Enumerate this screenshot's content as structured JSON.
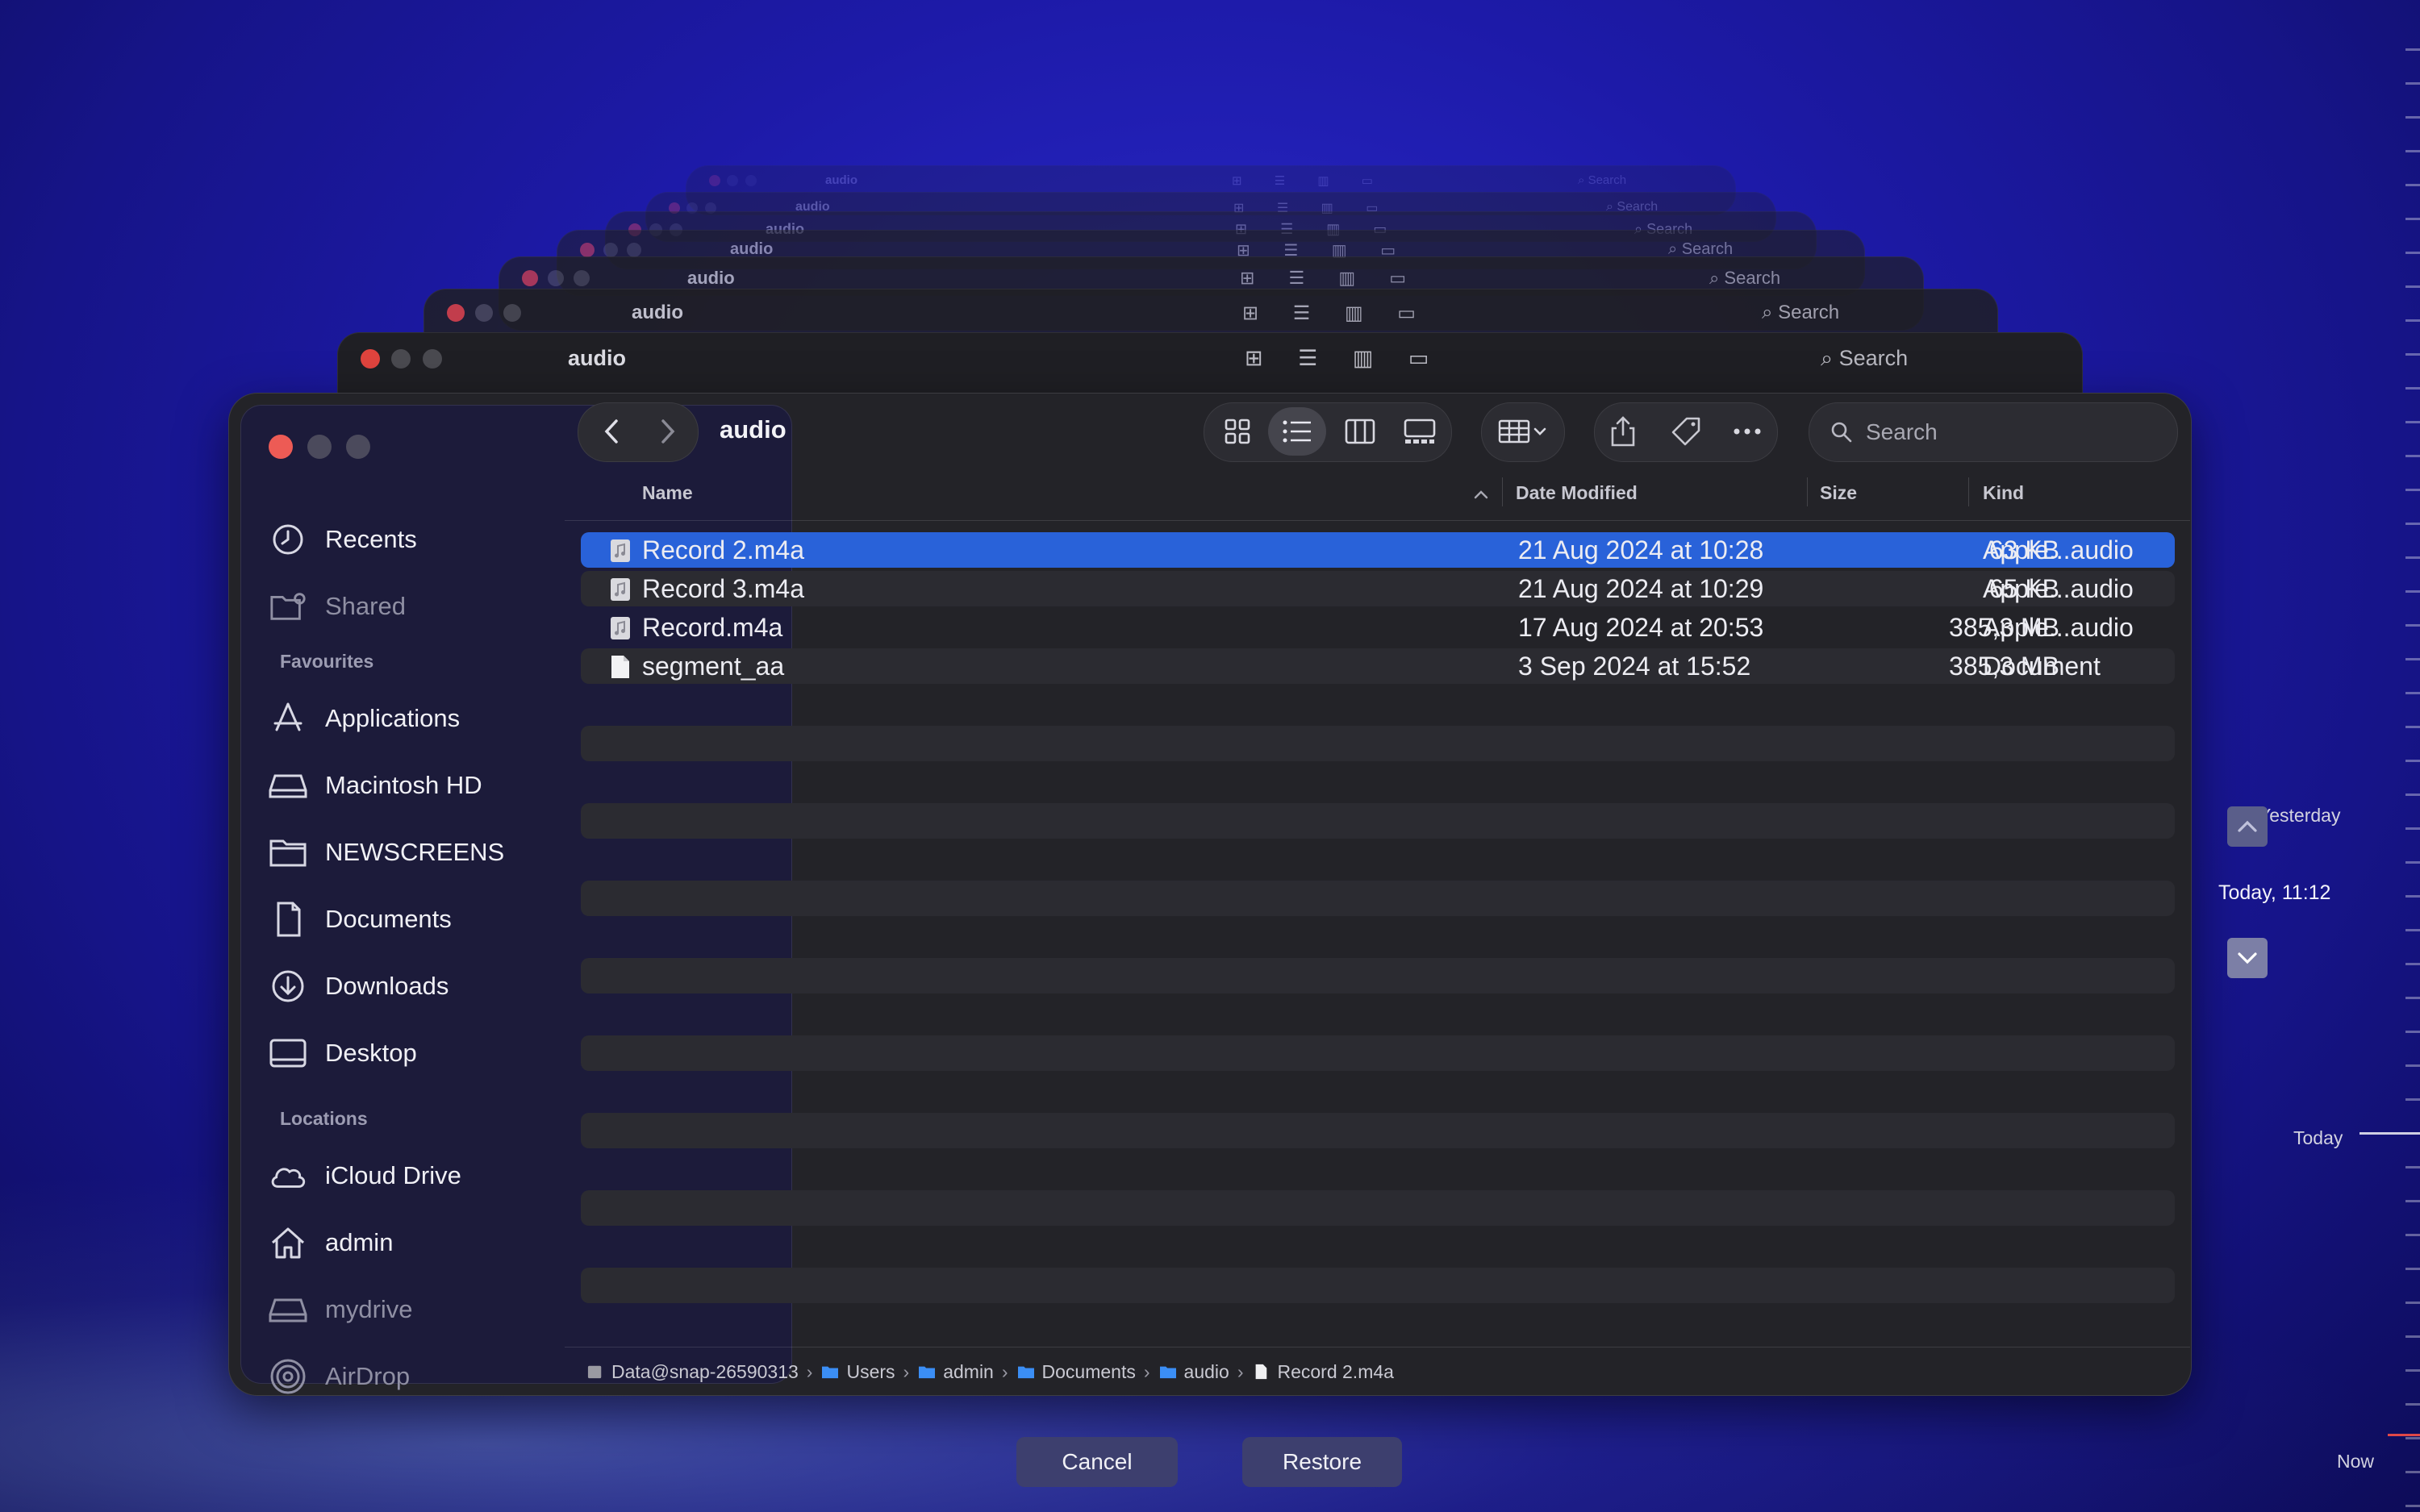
{
  "background_accent": "#1d1aa8",
  "ghost_windows": [
    {
      "title": "audio",
      "search": "Search"
    },
    {
      "title": "audio",
      "search": "Search"
    },
    {
      "title": "audio",
      "search": "Search"
    },
    {
      "title": "audio",
      "search": "Search"
    },
    {
      "title": "audio",
      "search": "Search"
    },
    {
      "title": "audio",
      "search": "Search"
    },
    {
      "title": "audio",
      "search": "Search"
    }
  ],
  "window": {
    "title": "audio",
    "search_placeholder": "Search"
  },
  "sidebar": {
    "top_items": [
      {
        "label": "Recents",
        "icon": "clock-icon"
      },
      {
        "label": "Shared",
        "icon": "shared-folder-icon"
      }
    ],
    "favourites_heading": "Favourites",
    "favourites": [
      {
        "label": "Applications",
        "icon": "applications-icon"
      },
      {
        "label": "Macintosh HD",
        "icon": "drive-icon"
      },
      {
        "label": "NEWSCREENS",
        "icon": "folder-icon"
      },
      {
        "label": "Documents",
        "icon": "document-icon"
      },
      {
        "label": "Downloads",
        "icon": "download-icon"
      },
      {
        "label": "Desktop",
        "icon": "desktop-icon"
      }
    ],
    "locations_heading": "Locations",
    "locations": [
      {
        "label": "iCloud Drive",
        "icon": "cloud-icon"
      },
      {
        "label": "admin",
        "icon": "home-icon"
      },
      {
        "label": "mydrive",
        "icon": "drive-icon"
      },
      {
        "label": "AirDrop",
        "icon": "airdrop-icon"
      }
    ]
  },
  "columns": {
    "name": "Name",
    "date": "Date Modified",
    "size": "Size",
    "kind": "Kind"
  },
  "files": [
    {
      "name": "Record 2.m4a",
      "date": "21 Aug 2024 at 10:28",
      "size": "63 KB",
      "kind": "Apple...audio",
      "selected": true
    },
    {
      "name": "Record 3.m4a",
      "date": "21 Aug 2024 at 10:29",
      "size": "65 KB",
      "kind": "Apple...audio",
      "selected": false
    },
    {
      "name": "Record.m4a",
      "date": "17 Aug 2024 at 20:53",
      "size": "385,3 MB",
      "kind": "Apple...audio",
      "selected": false
    },
    {
      "name": "segment_aa",
      "date": "3 Sep 2024 at 15:52",
      "size": "385,3 MB",
      "kind": "Document",
      "selected": false
    }
  ],
  "path_bar": [
    "Data@snap-26590313",
    "Users",
    "admin",
    "Documents",
    "audio",
    "Record 2.m4a"
  ],
  "buttons": {
    "cancel": "Cancel",
    "restore": "Restore"
  },
  "timeline": {
    "yesterday": "Yesterday",
    "current": "Today, 11:12",
    "today": "Today",
    "now": "Now"
  },
  "selection_color": "#2962d9"
}
